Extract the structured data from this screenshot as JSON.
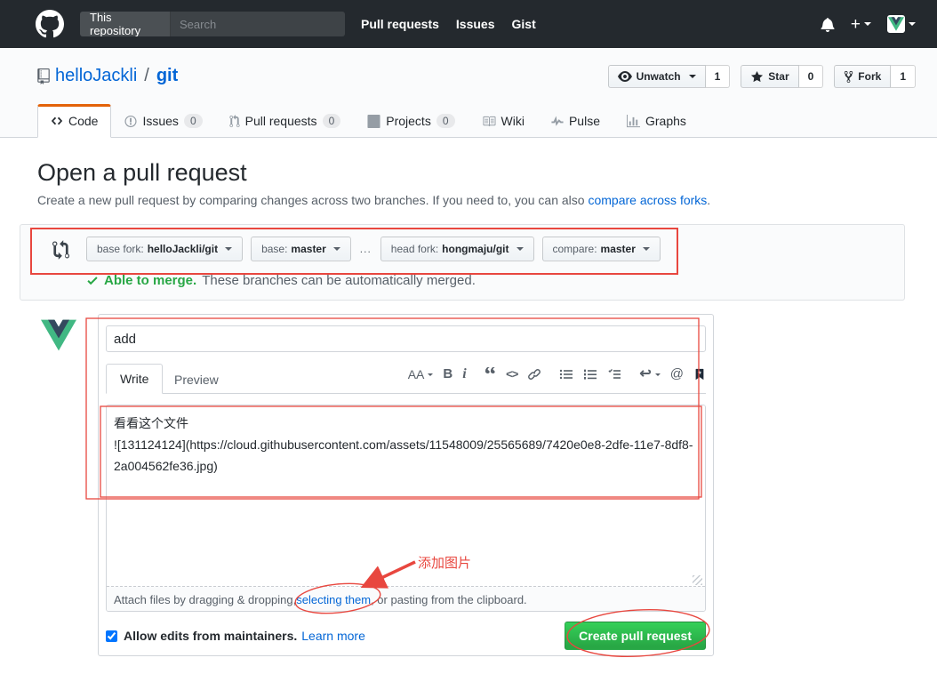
{
  "header": {
    "search_scope": "This repository",
    "search_placeholder": "Search",
    "plus": "+",
    "nav": [
      {
        "label": "Pull requests"
      },
      {
        "label": "Issues"
      },
      {
        "label": "Gist"
      }
    ]
  },
  "repo": {
    "owner": "helloJackli",
    "separator": "/",
    "name": "git",
    "actions": {
      "watch_label": "Unwatch",
      "watch_count": "1",
      "star_label": "Star",
      "star_count": "0",
      "fork_label": "Fork",
      "fork_count": "1"
    },
    "tabs": {
      "code": "Code",
      "issues": "Issues",
      "issues_count": "0",
      "pulls": "Pull requests",
      "pulls_count": "0",
      "projects": "Projects",
      "projects_count": "0",
      "wiki": "Wiki",
      "pulse": "Pulse",
      "graphs": "Graphs"
    }
  },
  "page": {
    "title": "Open a pull request",
    "subtitle": "Create a new pull request by comparing changes across two branches. If you need to, you can also ",
    "subtitle_link": "compare across forks",
    "subtitle_end": "."
  },
  "compare_bar": {
    "base_fork_label": "base fork:",
    "base_fork_value": "helloJackli/git",
    "base_label": "base:",
    "base_value": "master",
    "ellipsis": "...",
    "head_fork_label": "head fork:",
    "head_fork_value": "hongmaju/git",
    "compare_label": "compare:",
    "compare_value": "master",
    "merge_status": "Able to merge.",
    "merge_detail": " These branches can be automatically merged."
  },
  "form": {
    "title_value": "add",
    "write_tab": "Write",
    "preview_tab": "Preview",
    "toolbar": {
      "text_size": "AA",
      "bold": "B",
      "italic": "i",
      "quote": "“",
      "code": "<>",
      "reply": "↩",
      "mention": "@"
    },
    "body_value": "看看这个文件\n![131124124](https://cloud.githubusercontent.com/assets/11548009/25565689/7420e0e8-2dfe-11e7-8df8-2a004562fe36.jpg)",
    "attach_before": "Attach files by dragging & dropping, ",
    "attach_link": "selecting them",
    "attach_after": ", or pasting from the clipboard.",
    "allow_edits": "Allow edits from maintainers.",
    "learn_more": "Learn more",
    "submit": "Create pull request"
  },
  "annotations": {
    "add_image_label": "添加图片",
    "color": "#e8473f"
  },
  "colors": {
    "header_bg": "#24292e",
    "accent_blue": "#0366d6",
    "merge_green": "#28a745",
    "button_green": "#28a745",
    "tab_active_border": "#e36209",
    "annotation_red": "#e8473f"
  }
}
